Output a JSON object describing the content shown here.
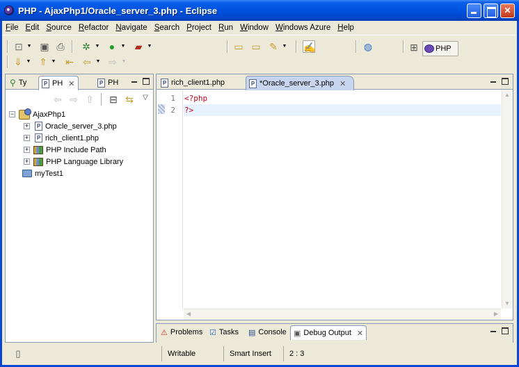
{
  "window": {
    "title": "PHP - AjaxPhp1/Oracle_server_3.php - Eclipse",
    "title_bar_color": "#0054e3"
  },
  "menu": [
    {
      "label": "File"
    },
    {
      "label": "Edit"
    },
    {
      "label": "Source"
    },
    {
      "label": "Refactor"
    },
    {
      "label": "Navigate"
    },
    {
      "label": "Search"
    },
    {
      "label": "Project"
    },
    {
      "label": "Run"
    },
    {
      "label": "Window"
    },
    {
      "label": "Windows Azure"
    },
    {
      "label": "Help"
    }
  ],
  "toolbar": {
    "perspective_label": "PHP",
    "icons": [
      "new-wizard-icon",
      "save-icon",
      "print-icon",
      "debug-icon",
      "run-icon",
      "external-tools-icon",
      "open-folder-icon",
      "open-project-icon",
      "open-type-icon",
      "highlight-icon",
      "globe-icon",
      "open-perspective-icon",
      "next-annotation-icon",
      "previous-annotation-icon",
      "last-edit-icon",
      "back-icon",
      "forward-icon"
    ]
  },
  "left_panel": {
    "tabs": [
      {
        "label": "Ty",
        "icon": "type-hierarchy-icon"
      },
      {
        "label": "PH",
        "icon": "php-explorer-icon"
      },
      {
        "label": "PH",
        "icon": "php-functions-icon"
      }
    ],
    "tree": [
      {
        "label": "AjaxPhp1",
        "icon": "php-project-icon",
        "level": 0,
        "expander": "−"
      },
      {
        "label": "Oracle_server_3.php",
        "icon": "php-file-icon",
        "level": 1,
        "expander": "+"
      },
      {
        "label": "rich_client1.php",
        "icon": "php-file-icon",
        "level": 1,
        "expander": "+"
      },
      {
        "label": "PHP Include Path",
        "icon": "library-icon",
        "level": 1,
        "expander": "+"
      },
      {
        "label": "PHP Language Library",
        "icon": "library-icon",
        "level": 1,
        "expander": "+"
      },
      {
        "label": "myTest1",
        "icon": "folder-icon",
        "level": 0,
        "expander": ""
      }
    ]
  },
  "editor": {
    "tabs": [
      {
        "label": "rich_client1.php",
        "active": false
      },
      {
        "label": "*Oracle_server_3.php",
        "active": true
      }
    ],
    "lines": [
      {
        "number": "1",
        "text": "<?php"
      },
      {
        "number": "2",
        "text": "?>"
      }
    ],
    "current_line": 2,
    "code_color": "#c0001b",
    "current_line_color": "#e8f2fe"
  },
  "bottom_panel": {
    "tabs": [
      {
        "label": "Problems",
        "icon": "problems-icon"
      },
      {
        "label": "Tasks",
        "icon": "tasks-icon"
      },
      {
        "label": "Console",
        "icon": "console-icon"
      },
      {
        "label": "Debug Output",
        "icon": "debug-output-icon"
      }
    ]
  },
  "status_bar": {
    "writable": "Writable",
    "insert_mode": "Smart Insert",
    "position": "2 : 3"
  }
}
